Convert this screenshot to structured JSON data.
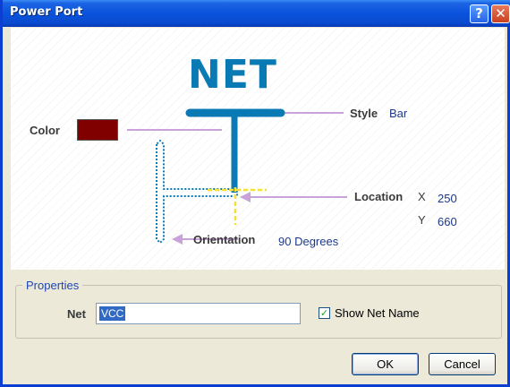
{
  "window": {
    "title": "Power Port"
  },
  "diagram": {
    "net_text": "NET",
    "style_label": "Style",
    "style_value": "Bar",
    "color_label": "Color",
    "color_value": "#800000",
    "location_label": "Location",
    "x_label": "X",
    "x_value": "250",
    "y_label": "Y",
    "y_value": "660",
    "orientation_label": "Orientation",
    "orientation_value": "90 Degrees"
  },
  "properties": {
    "group_label": "Properties",
    "net_label": "Net",
    "net_value": "VCC",
    "show_net_name_label": "Show Net Name",
    "show_net_name_checked": true
  },
  "buttons": {
    "ok_label": "OK",
    "cancel_label": "Cancel"
  },
  "colors": {
    "title_bar": "#0a53dc",
    "net_symbol": "#0a7ab5",
    "pointer_line": "#c8a2d8",
    "location_marker": "#f5e03a",
    "selection": "#316ac5"
  },
  "icons": {
    "help": "help-icon",
    "close": "close-icon",
    "check": "checkmark-icon"
  }
}
